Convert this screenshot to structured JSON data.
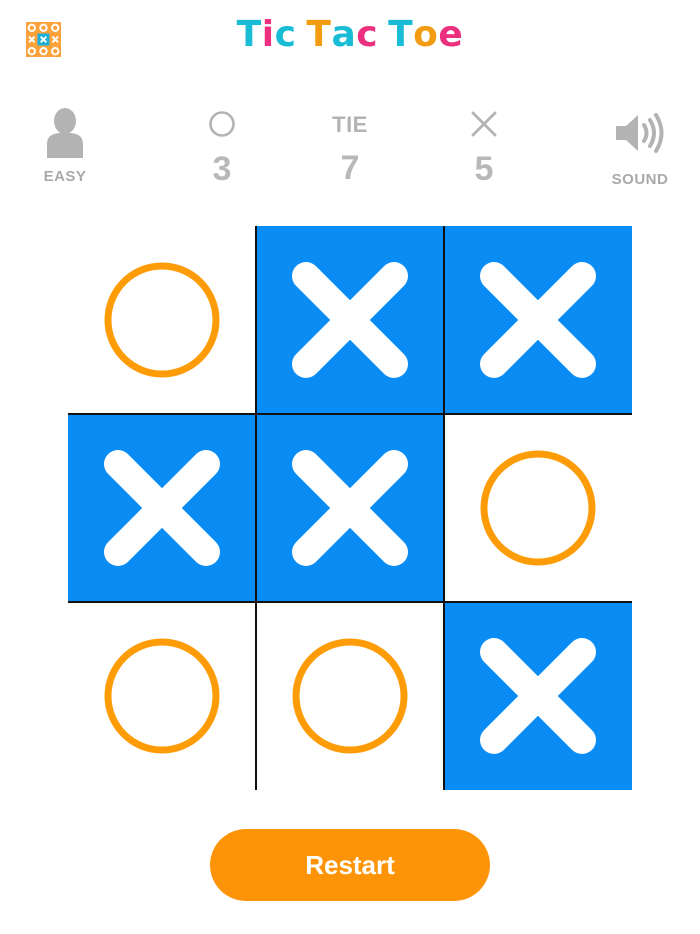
{
  "title": [
    "T",
    "i",
    "c",
    " ",
    "T",
    "a",
    "c",
    " ",
    "T",
    "o",
    "e"
  ],
  "title_colors": [
    "#18bcd4",
    "#ec2f7e",
    "#18bcd4",
    "",
    "#f39c12",
    "#18bcd4",
    "#ec2f7e",
    "",
    "#18bcd4",
    "#f39c12",
    "#ec2f7e"
  ],
  "score": {
    "difficulty_label": "EASY",
    "o_wins": "3",
    "tie_label": "TIE",
    "ties": "7",
    "x_wins": "5",
    "sound_label": "SOUND"
  },
  "board": [
    [
      "O",
      "X",
      "X"
    ],
    [
      "X",
      "X",
      "O"
    ],
    [
      "O",
      "O",
      "X"
    ]
  ],
  "colors": {
    "x_cell_bg": "#0a8cf5",
    "o_ring": "#fd9c07",
    "restart_bg": "#fd9407"
  },
  "icons": {
    "app": "tic-tac-toe-grid-icon",
    "difficulty": "user-silhouette-icon",
    "o": "circle-icon",
    "x": "cross-icon",
    "sound": "speaker-icon"
  },
  "restart_label": "Restart"
}
